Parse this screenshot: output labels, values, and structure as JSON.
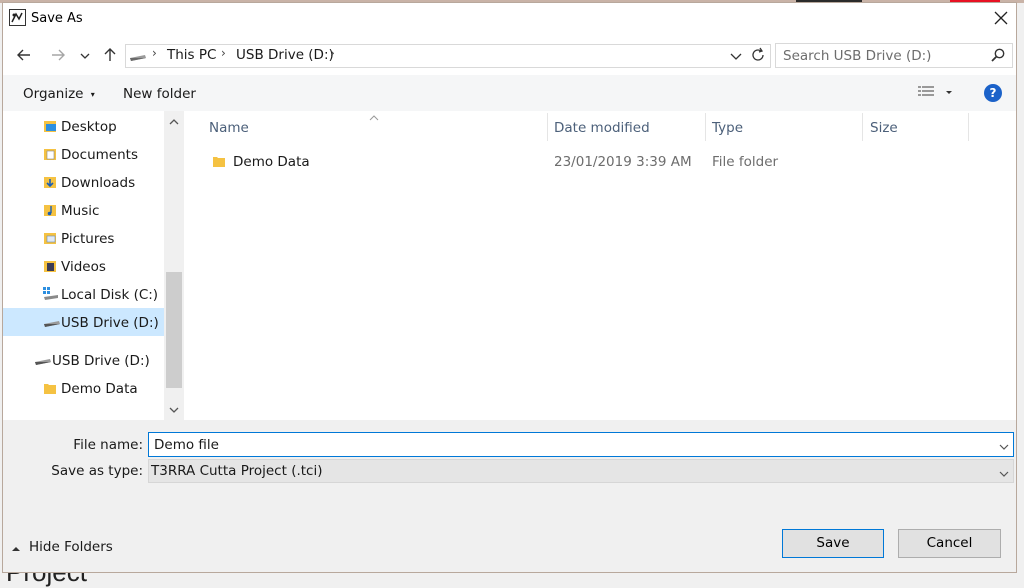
{
  "window": {
    "title": "Save As"
  },
  "address": {
    "crumbs": [
      "This PC",
      "USB Drive (D:)"
    ],
    "search_placeholder": "Search USB Drive (D:)"
  },
  "toolbar": {
    "organize": "Organize",
    "new_folder": "New folder"
  },
  "nav": {
    "items": [
      {
        "label": "Desktop",
        "icon": "desktop-folder-icon"
      },
      {
        "label": "Documents",
        "icon": "documents-folder-icon"
      },
      {
        "label": "Downloads",
        "icon": "downloads-folder-icon"
      },
      {
        "label": "Music",
        "icon": "music-folder-icon"
      },
      {
        "label": "Pictures",
        "icon": "pictures-folder-icon"
      },
      {
        "label": "Videos",
        "icon": "videos-folder-icon"
      },
      {
        "label": "Local Disk (C:)",
        "icon": "local-disk-icon"
      },
      {
        "label": "USB Drive (D:)",
        "icon": "usb-drive-icon",
        "selected": true
      },
      {
        "label": "USB Drive (D:)",
        "icon": "usb-drive-icon"
      },
      {
        "label": "Demo Data",
        "icon": "folder-icon"
      }
    ]
  },
  "list": {
    "columns": [
      "Name",
      "Date modified",
      "Type",
      "Size"
    ],
    "rows": [
      {
        "name": "Demo Data",
        "date": "23/01/2019 3:39 AM",
        "type": "File folder",
        "size": ""
      }
    ]
  },
  "form": {
    "file_name_label": "File name:",
    "file_name_value": "Demo file",
    "save_type_label": "Save as type:",
    "save_type_value": "T3RRA Cutta Project (.tci)"
  },
  "footer": {
    "hide_folders": "Hide Folders",
    "save": "Save",
    "cancel": "Cancel"
  },
  "background": {
    "partial_text": "Project"
  },
  "colors": {
    "accent": "#0078d7",
    "selected": "#cce8ff",
    "help": "#1b62c9",
    "folder": "#f5c242"
  }
}
